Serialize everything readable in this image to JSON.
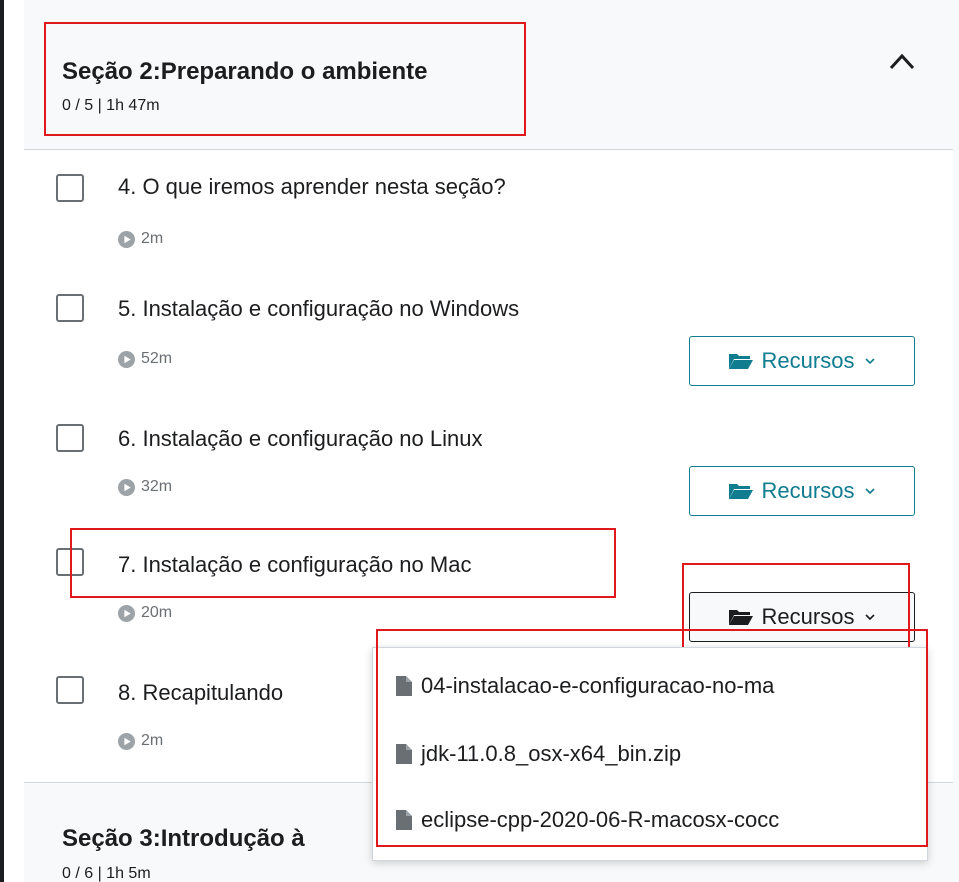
{
  "section": {
    "title": "Seção 2:Preparando o ambiente",
    "meta": "0 / 5 | 1h 47m",
    "collapse_icon": "chevron-up-icon"
  },
  "lectures": [
    {
      "title": "4. O que iremos aprender nesta seção?",
      "duration": "2m",
      "resources": null
    },
    {
      "title": "5. Instalação e configuração no Windows",
      "duration": "52m",
      "resources": "Recursos"
    },
    {
      "title": "6. Instalação e configuração no Linux",
      "duration": "32m",
      "resources": "Recursos"
    },
    {
      "title": "7. Instalação e configuração no Mac",
      "duration": "20m",
      "resources": "Recursos"
    },
    {
      "title": "8. Recapitulando",
      "duration": "2m",
      "resources": null
    }
  ],
  "dropdown": {
    "items": [
      "04-instalacao-e-configuracao-no-ma",
      "jdk-11.0.8_osx-x64_bin.zip",
      "eclipse-cpp-2020-06-R-macosx-cocc"
    ]
  },
  "next_section": {
    "title": "Seção 3:Introdução à",
    "meta": "0 / 6 | 1h 5m"
  },
  "colors": {
    "accent": "#0f7c90",
    "highlight": "#e0191d",
    "text": "#1c1d1f",
    "muted": "#6a6f73"
  }
}
